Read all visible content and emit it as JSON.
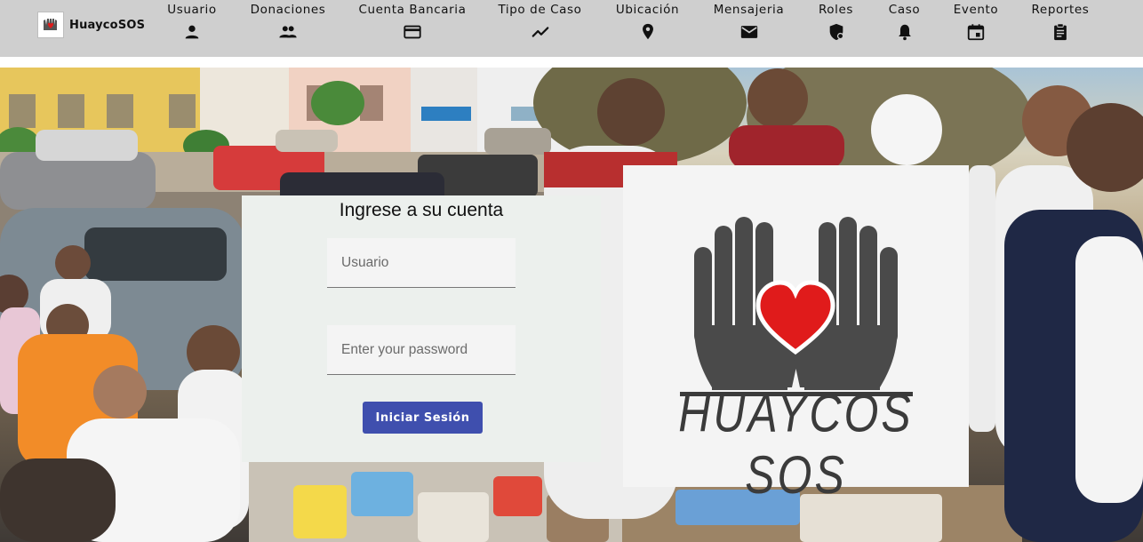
{
  "navbar": {
    "brand": {
      "name": "HuaycoSOS"
    },
    "items": [
      {
        "label": "Usuario",
        "icon": "person-icon"
      },
      {
        "label": "Donaciones",
        "icon": "people-icon"
      },
      {
        "label": "Cuenta Bancaria",
        "icon": "credit-card-icon"
      },
      {
        "label": "Tipo de Caso",
        "icon": "trending-icon"
      },
      {
        "label": "Ubicación",
        "icon": "location-pin-icon"
      },
      {
        "label": "Mensajeria",
        "icon": "mail-icon"
      },
      {
        "label": "Roles",
        "icon": "shield-icon"
      },
      {
        "label": "Caso",
        "icon": "bell-icon"
      },
      {
        "label": "Evento",
        "icon": "calendar-icon"
      },
      {
        "label": "Reportes",
        "icon": "clipboard-icon"
      }
    ]
  },
  "login": {
    "title": "Ingrese a su cuenta",
    "username_placeholder": "Usuario",
    "password_placeholder": "Enter your password",
    "submit_label": "Iniciar Sesión"
  },
  "logo": {
    "text": "HUAYCOS SOS",
    "colors": {
      "hands": "#4a4a4a",
      "heart": "#e01b1b"
    }
  },
  "colors": {
    "navbar_bg": "#cfcfcf",
    "login_card_bg": "#ecf0ed",
    "primary_button": "#3f4fae"
  }
}
